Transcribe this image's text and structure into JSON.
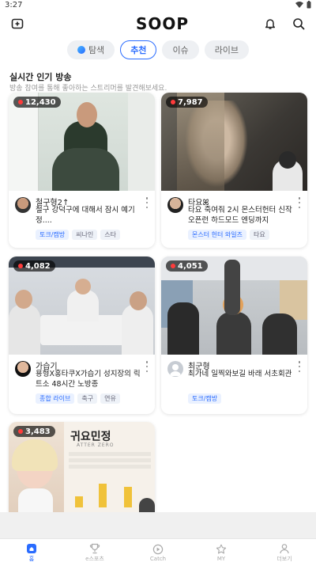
{
  "status": {
    "time": "3:27"
  },
  "header": {
    "logo": "SOOP"
  },
  "tabs": [
    {
      "label": "탐색"
    },
    {
      "label": "추천"
    },
    {
      "label": "이슈"
    },
    {
      "label": "라이브"
    }
  ],
  "section": {
    "title": "실시간 인기 방송",
    "subtitle": "방송 참여를 통해 좋아하는 스트리머를 발견해보세요."
  },
  "cards": [
    {
      "viewers": "12,430",
      "streamer": "철구형2↑",
      "title": "철구 강덕구에 대해서 잠시 예기 정....",
      "tags": [
        "토크/캠방",
        "씨나인",
        "스타"
      ]
    },
    {
      "viewers": "7,987",
      "streamer": "타요ꕤ",
      "title": "타요 죽여줘 2시 몬스터헌터 신작 오픈런 하드모드 엔딩까지",
      "tags": [
        "몬스터 헌터 와일즈",
        "타요"
      ]
    },
    {
      "viewers": "4,082",
      "streamer": "가습기",
      "title": "용형X홍타쿠X가습기 성지장의 릭트소 48시간 노방종",
      "tags": [
        "종합 라이브",
        "축구",
        "연유"
      ]
    },
    {
      "viewers": "4,051",
      "streamer": "최군형",
      "title": "최가네 일찍와보길 바래 서초회관",
      "tags": [
        "토크/캠방"
      ]
    },
    {
      "viewers": "3,483",
      "overlay_title": "귀요민정",
      "overlay_sub": "ATTER ZERO"
    }
  ],
  "nav": [
    {
      "label": "홈",
      "icon": "home-icon"
    },
    {
      "label": "e스포츠",
      "icon": "trophy-icon"
    },
    {
      "label": "Catch",
      "icon": "play-circle-icon"
    },
    {
      "label": "MY",
      "icon": "star-icon"
    },
    {
      "label": "더보기",
      "icon": "person-icon"
    }
  ],
  "colors": {
    "accent": "#2a6cff",
    "live_dot": "#ff3b3b"
  }
}
